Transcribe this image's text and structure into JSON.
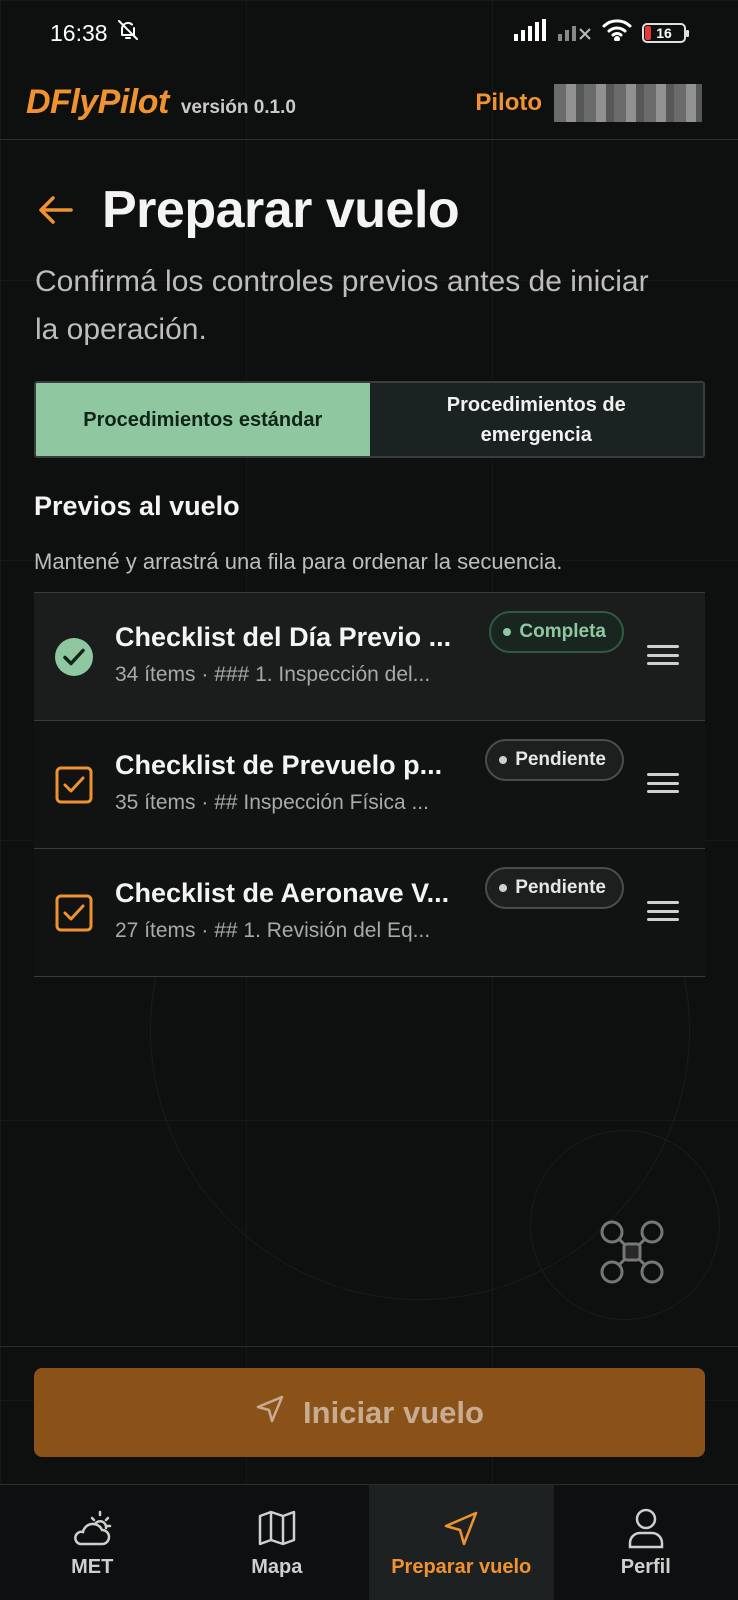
{
  "status_bar": {
    "time": "16:38",
    "battery": "16"
  },
  "header": {
    "logo": "DFlyPilot",
    "version": "versión 0.1.0",
    "pilot_label": "Piloto"
  },
  "page": {
    "title": "Preparar vuelo",
    "subtitle": "Confirmá los controles previos antes de iniciar la operación."
  },
  "tabs": [
    {
      "label": "Procedimientos estándar",
      "active": true
    },
    {
      "label": "Procedimientos de emergencia",
      "active": false
    }
  ],
  "section": {
    "title": "Previos al vuelo",
    "hint": "Mantené y arrastrá una fila para ordenar la secuencia."
  },
  "checklists": [
    {
      "title": "Checklist del Día Previo ...",
      "subtitle": "34 ítems · ### 1. Inspección del...",
      "status": "Completa",
      "completed": true
    },
    {
      "title": "Checklist de Prevuelo p...",
      "subtitle": "35 ítems · ## Inspección Física ...",
      "status": "Pendiente",
      "completed": false
    },
    {
      "title": "Checklist de Aeronave V...",
      "subtitle": "27 ítems · ## 1. Revisión del Eq...",
      "status": "Pendiente",
      "completed": false
    }
  ],
  "actions": {
    "start_label": "Iniciar vuelo"
  },
  "bottom_nav": [
    {
      "label": "MET",
      "icon": "cloud-sun-icon",
      "active": false
    },
    {
      "label": "Mapa",
      "icon": "map-icon",
      "active": false
    },
    {
      "label": "Preparar vuelo",
      "icon": "navigation-icon",
      "active": true
    },
    {
      "label": "Perfil",
      "icon": "user-icon",
      "active": false
    }
  ],
  "colors": {
    "accent": "#f0922f",
    "success": "#8fc8a0",
    "background": "#0e0f0f",
    "button": "#8a5218"
  }
}
